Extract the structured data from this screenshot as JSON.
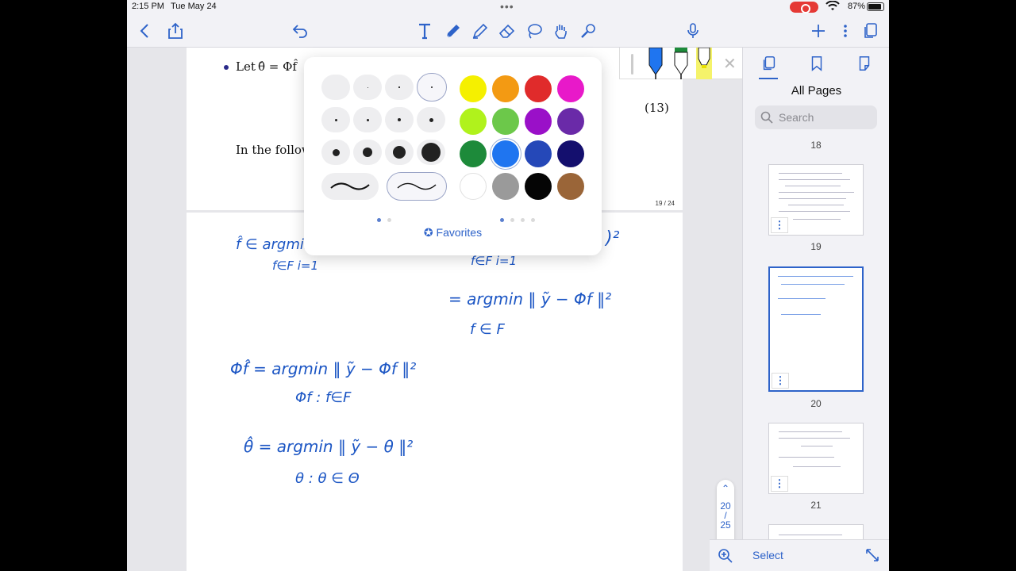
{
  "status_bar": {
    "time": "2:15 PM",
    "date": "Tue May 24",
    "battery": "87%"
  },
  "toolbar": {
    "back_icon": "chevron-left-icon",
    "share_icon": "share-icon",
    "undo_icon": "undo-icon",
    "tools": [
      "text-tool-icon",
      "pen-tool-icon",
      "highlighter-tool-icon",
      "eraser-tool-icon",
      "lasso-tool-icon",
      "hand-tool-icon",
      "laser-pointer-icon"
    ],
    "mic_icon": "microphone-icon",
    "add_icon": "plus-icon",
    "more_icon": "more-vertical-icon",
    "pages_icon": "pages-icon"
  },
  "document": {
    "page19": {
      "bullet_text": "Let",
      "math": "θ̂ = Φf̂",
      "eq_number": "(13)",
      "body_text": "In the follow",
      "page_label": "19 / 24"
    },
    "handwriting": {
      "line1_a": "f̂ ∈ argmin",
      "line1_b": "f∈F   i=1",
      "line1_c": "f∈F  i=1",
      "line1_d": ")²",
      "line2": "=  argmin ‖ ỹ − Φf ‖²",
      "line2_sub": "f ∈ F",
      "line3": "Φf̂  =  argmin  ‖ ỹ − Φf ‖²",
      "line3_sub": "Φf : f∈F",
      "line4": "θ̂   =   argmin   ‖ ỹ − θ ‖²",
      "line4_sub": "θ : θ ∈ Θ"
    }
  },
  "pen_popover": {
    "favorites_label": "Favorites",
    "colors": [
      "#f5f000",
      "#f39a13",
      "#e02b2b",
      "#e819c9",
      "#b0f21c",
      "#6cc84a",
      "#9a10c8",
      "#6a2aa8",
      "#1d8a3a",
      "#1f75f0",
      "#2548b8",
      "#140f6e",
      "#ffffff",
      "#9a9a9a",
      "#050505",
      "#9a6538"
    ],
    "selected_color": "#1f75f0"
  },
  "pens_strip": {
    "pens": [
      "blue-pen-icon",
      "green-pen-icon",
      "yellow-highlighter-icon"
    ],
    "close_icon": "close-icon"
  },
  "sidebar": {
    "tabs": [
      "pages-tab-icon",
      "bookmarks-tab-icon",
      "outline-tab-icon"
    ],
    "title": "All Pages",
    "search_placeholder": "Search",
    "page_numbers": [
      "18",
      "19",
      "20",
      "21"
    ],
    "selected_page": "20"
  },
  "pager": {
    "current": "20",
    "total": "25",
    "divider": "/"
  },
  "bottom_bar": {
    "select_label": "Select"
  }
}
